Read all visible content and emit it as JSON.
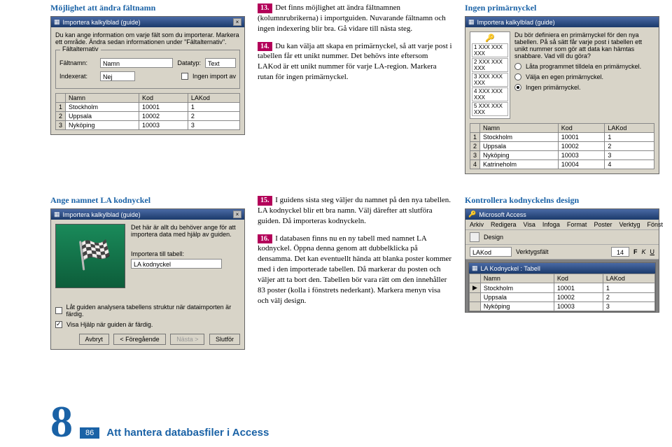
{
  "row1": {
    "colA": {
      "heading": "Möjlighet att ändra fältnamn",
      "win_title": "Importera kalkylblad (guide)",
      "instr": "Du kan ange information om varje fält som du importerar. Markera ett område. Ändra sedan informationen under \"Fältalternativ\".",
      "group_label": "Fältalternativ",
      "lbl_faltnamn": "Fältnamn:",
      "val_faltnamn": "Namn",
      "lbl_datatyp": "Datatyp:",
      "val_datatyp": "Text",
      "lbl_indexerat": "Indexerat:",
      "val_indexerat": "Nej",
      "cbx_ingen": "Ingen import av",
      "tbl": {
        "cols": [
          "Namn",
          "Kod",
          "LAKod"
        ],
        "rows": [
          [
            "1",
            "Stockholm",
            "10001",
            "1"
          ],
          [
            "2",
            "Uppsala",
            "10002",
            "2"
          ],
          [
            "3",
            "Nyköping",
            "10003",
            "3"
          ]
        ]
      }
    },
    "colB": {
      "step13": "Det finns möjlighet att ändra fältnamnen (kolumnrubrikerna) i importguiden. Nuvarande fältnamn och ingen indexering blir bra. Gå vidare till nästa steg.",
      "step14": "Du kan välja att skapa en primärnyckel, så att varje post i tabellen får ett unikt nummer. Det behövs inte eftersom LAKod är ett unikt nummer för varje LA-region. Markera rutan för ingen primärnyckel.",
      "tag13": "13.",
      "tag14": "14."
    },
    "colC": {
      "heading": "Ingen primärnyckel",
      "win_title": "Importera kalkylblad (guide)",
      "desc": "Du bör definiera en primärnyckel för den nya tabellen. På så sätt får varje post i tabellen ett unikt nummer som gör att data kan hämtas snabbare. Vad vill du göra?",
      "r1": "Låta programmet tilldela en primärnyckel.",
      "r2": "Välja en egen primärnyckel.",
      "r3": "Ingen primärnyckel.",
      "grid_left": [
        "1  XXX XXX XXX",
        "2  XXX XXX XXX",
        "3  XXX XXX XXX",
        "4  XXX XXX XXX",
        "5  XXX XXX XXX"
      ],
      "tbl": {
        "cols": [
          "Namn",
          "Kod",
          "LAKod"
        ],
        "rows": [
          [
            "1",
            "Stockholm",
            "10001",
            "1"
          ],
          [
            "2",
            "Uppsala",
            "10002",
            "2"
          ],
          [
            "3",
            "Nyköping",
            "10003",
            "3"
          ],
          [
            "4",
            "Katrineholm",
            "10004",
            "4"
          ]
        ]
      }
    }
  },
  "row2": {
    "colA": {
      "heading": "Ange namnet LA kodnyckel",
      "win_title": "Importera kalkylblad (guide)",
      "intro": "Det här är allt du behöver ange för att importera data med hjälp av guiden.",
      "lbl_import": "Importera till tabell:",
      "val_import": "LA kodnyckel",
      "cbx1": "Låt guiden analysera tabellens struktur när dataimporten är färdig.",
      "cbx2": "Visa Hjälp när guiden är färdig.",
      "btns": [
        "Avbryt",
        "< Föregående",
        "Nästa >",
        "Slutför"
      ]
    },
    "colB": {
      "tag15": "15.",
      "step15": "I guidens sista steg väljer du namnet på den nya tabellen. LA kodnyckel blir ett bra namn. Välj därefter att slutföra guiden. Då importeras kodnyckeln.",
      "tag16": "16.",
      "step16": "I databasen finns nu en ny tabell med namnet LA kodnyckel. Öppna denna genom att dubbelklicka på densamma. Det kan eventuellt hända att blanka poster kommer med i den importerade tabellen. Då markerar du posten och väljer att ta bort den. Tabellen bör vara rätt om den innehåller 83 poster (kolla i fönstrets nederkant). Markera menyn visa och välj design."
    },
    "colC": {
      "heading": "Kontrollera kodnyckelns design",
      "access_title": "Microsoft Access",
      "menus": [
        "Arkiv",
        "Redigera",
        "Visa",
        "Infoga",
        "Format",
        "Poster",
        "Verktyg",
        "Fönst"
      ],
      "design_label": "Design",
      "tool_table": "LAKod",
      "tool_verk": "Verktygsfält",
      "tool_size": "14",
      "subwin_title": "LA Kodnyckel : Tabell",
      "tbl": {
        "cols": [
          "Namn",
          "Kod",
          "LAKod"
        ],
        "rows": [
          [
            "▶",
            "Stockholm",
            "10001",
            "1"
          ],
          [
            "",
            "Uppsala",
            "10002",
            "2"
          ],
          [
            "",
            "Nyköping",
            "10003",
            "3"
          ]
        ]
      }
    }
  },
  "footer": {
    "chapter_num": "8",
    "page_num": "86",
    "chapter_title": "Att hantera databasfiler i Access"
  }
}
